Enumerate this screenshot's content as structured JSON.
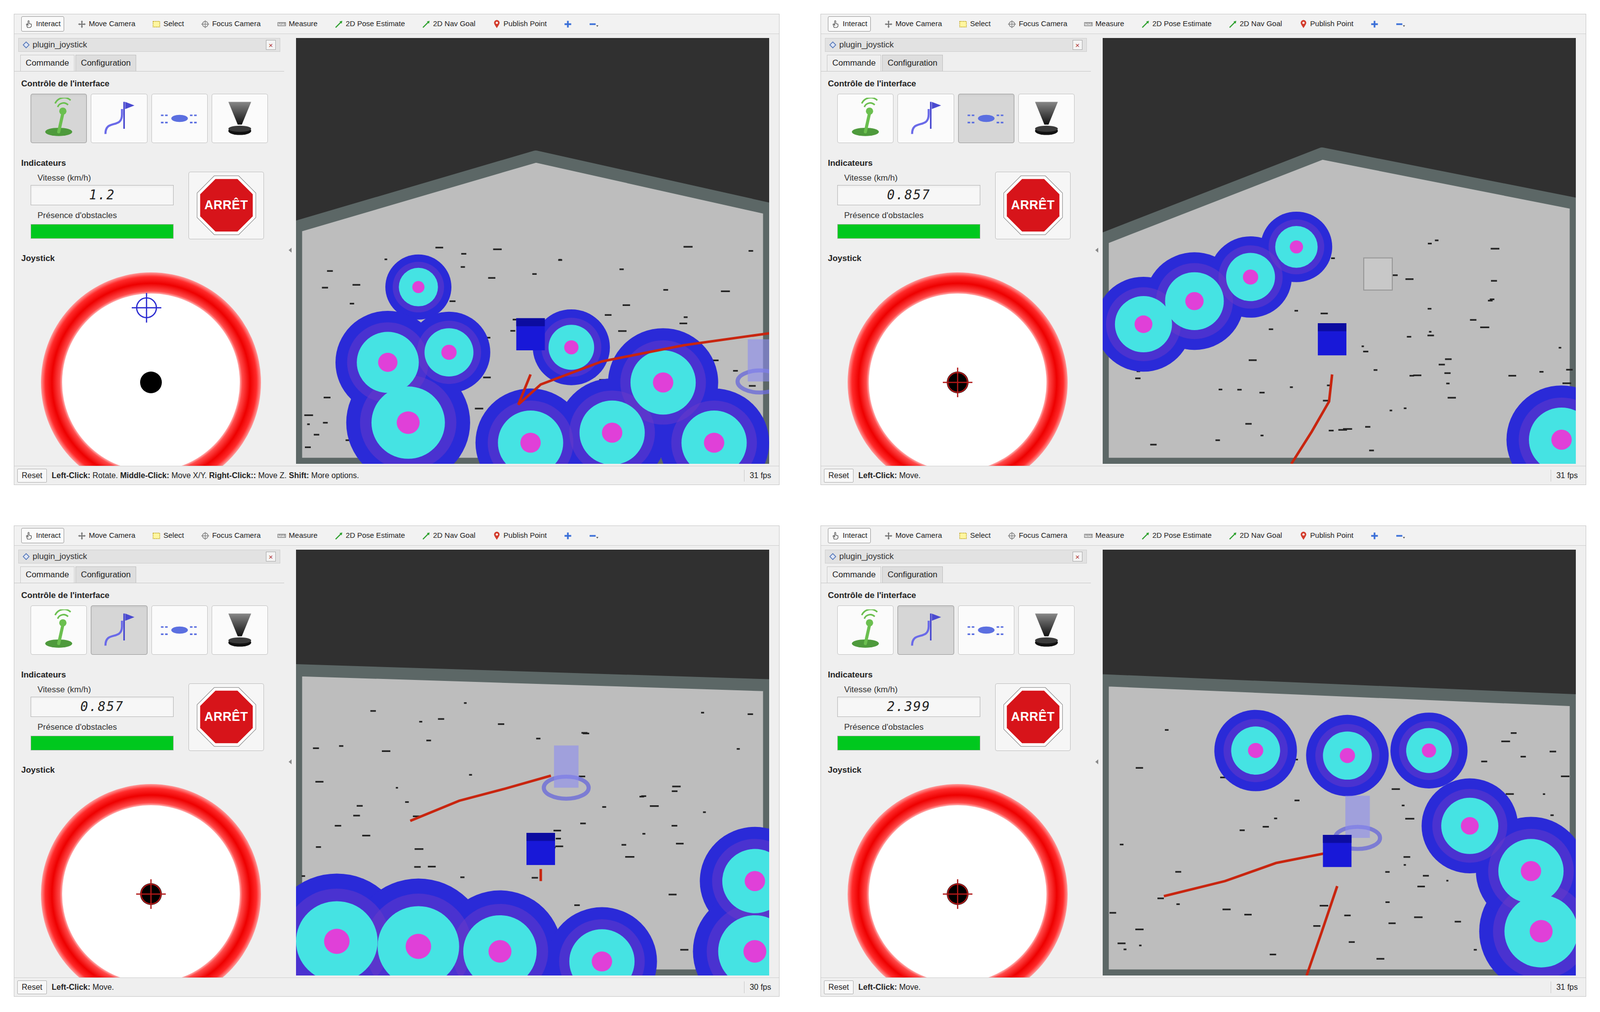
{
  "screens": [
    {
      "toolbar": [
        {
          "label": "Interact",
          "kind": "interact",
          "selected": true
        },
        {
          "label": "Move Camera",
          "kind": "move",
          "selected": false
        },
        {
          "label": "Select",
          "kind": "select",
          "selected": false
        },
        {
          "label": "Focus Camera",
          "kind": "focus",
          "selected": false
        },
        {
          "label": "Measure",
          "kind": "measure",
          "selected": false
        },
        {
          "label": "2D Pose Estimate",
          "kind": "pose",
          "selected": false
        },
        {
          "label": "2D Nav Goal",
          "kind": "goal",
          "selected": false
        },
        {
          "label": "Publish Point",
          "kind": "point",
          "selected": false
        },
        {
          "kind": "plus",
          "selected": false
        },
        {
          "kind": "minus",
          "selected": false
        }
      ],
      "dock_title": "plugin_joystick",
      "close": "×",
      "tabs": [
        {
          "label": "Commande",
          "selected": true
        },
        {
          "label": "Configuration",
          "selected": false
        }
      ],
      "mode_heading": "Contrôle de l'interface",
      "modes": [
        {
          "kind": "joystick",
          "selected": true
        },
        {
          "kind": "path",
          "selected": false
        },
        {
          "kind": "drone",
          "selected": false
        },
        {
          "kind": "cone",
          "selected": false
        }
      ],
      "indicators_heading": "Indicateurs",
      "speed_label": "Vitesse (km/h)",
      "speed": "1.2",
      "obstacle_label": "Présence d'obstacles",
      "obstacle_level": 1,
      "obstacle_color": "#00c81e",
      "stop_label": "ARRÊT",
      "joystick_label": "Joystick",
      "joystick_target": {
        "x": -0.05,
        "y": 0.84
      },
      "reset": "Reset",
      "hint": [
        {
          "text": "Left-Click:",
          "bold": true
        },
        {
          "text": " Rotate. ",
          "bold": false
        },
        {
          "text": "Middle-Click:",
          "bold": true
        },
        {
          "text": " Move X/Y. ",
          "bold": false
        },
        {
          "text": "Right-Click::",
          "bold": true
        },
        {
          "text": " Move Z. ",
          "bold": false
        },
        {
          "text": "Shift:",
          "bold": true
        },
        {
          "text": " More options.",
          "bold": false
        }
      ],
      "fps": "31 fps"
    },
    {
      "toolbar": [
        {
          "label": "Interact",
          "kind": "interact",
          "selected": true
        },
        {
          "label": "Move Camera",
          "kind": "move",
          "selected": false
        },
        {
          "label": "Select",
          "kind": "select",
          "selected": false
        },
        {
          "label": "Focus Camera",
          "kind": "focus",
          "selected": false
        },
        {
          "label": "Measure",
          "kind": "measure",
          "selected": false
        },
        {
          "label": "2D Pose Estimate",
          "kind": "pose",
          "selected": false
        },
        {
          "label": "2D Nav Goal",
          "kind": "goal",
          "selected": false
        },
        {
          "label": "Publish Point",
          "kind": "point",
          "selected": false
        },
        {
          "kind": "plus",
          "selected": false
        },
        {
          "kind": "minus",
          "selected": false
        }
      ],
      "dock_title": "plugin_joystick",
      "close": "×",
      "tabs": [
        {
          "label": "Commande",
          "selected": true
        },
        {
          "label": "Configuration",
          "selected": false
        }
      ],
      "mode_heading": "Contrôle de l'interface",
      "modes": [
        {
          "kind": "joystick",
          "selected": false
        },
        {
          "kind": "path",
          "selected": false
        },
        {
          "kind": "drone",
          "selected": true
        },
        {
          "kind": "cone",
          "selected": false
        }
      ],
      "indicators_heading": "Indicateurs",
      "speed_label": "Vitesse (km/h)",
      "speed": "0.857",
      "obstacle_label": "Présence d'obstacles",
      "obstacle_level": 1,
      "obstacle_color": "#00c81e",
      "stop_label": "ARRÊT",
      "joystick_label": "Joystick",
      "joystick_target": {
        "x": 0,
        "y": 0
      },
      "reset": "Reset",
      "hint": [
        {
          "text": "Left-Click:",
          "bold": true
        },
        {
          "text": " Move.",
          "bold": false
        }
      ],
      "fps": "31 fps"
    },
    {
      "toolbar": [
        {
          "label": "Interact",
          "kind": "interact",
          "selected": true
        },
        {
          "label": "Move Camera",
          "kind": "move",
          "selected": false
        },
        {
          "label": "Select",
          "kind": "select",
          "selected": false
        },
        {
          "label": "Focus Camera",
          "kind": "focus",
          "selected": false
        },
        {
          "label": "Measure",
          "kind": "measure",
          "selected": false
        },
        {
          "label": "2D Pose Estimate",
          "kind": "pose",
          "selected": false
        },
        {
          "label": "2D Nav Goal",
          "kind": "goal",
          "selected": false
        },
        {
          "label": "Publish Point",
          "kind": "point",
          "selected": false
        },
        {
          "kind": "plus",
          "selected": false
        },
        {
          "kind": "minus",
          "selected": false
        }
      ],
      "dock_title": "plugin_joystick",
      "close": "×",
      "tabs": [
        {
          "label": "Commande",
          "selected": true
        },
        {
          "label": "Configuration",
          "selected": false
        }
      ],
      "mode_heading": "Contrôle de l'interface",
      "modes": [
        {
          "kind": "joystick",
          "selected": false
        },
        {
          "kind": "path",
          "selected": true
        },
        {
          "kind": "drone",
          "selected": false
        },
        {
          "kind": "cone",
          "selected": false
        }
      ],
      "indicators_heading": "Indicateurs",
      "speed_label": "Vitesse (km/h)",
      "speed": "0.857",
      "obstacle_label": "Présence d'obstacles",
      "obstacle_level": 1,
      "obstacle_color": "#00c81e",
      "stop_label": "ARRÊT",
      "joystick_label": "Joystick",
      "joystick_target": {
        "x": 0,
        "y": 0
      },
      "reset": "Reset",
      "hint": [
        {
          "text": "Left-Click:",
          "bold": true
        },
        {
          "text": " Move.",
          "bold": false
        }
      ],
      "fps": "30 fps"
    },
    {
      "toolbar": [
        {
          "label": "Interact",
          "kind": "interact",
          "selected": true
        },
        {
          "label": "Move Camera",
          "kind": "move",
          "selected": false
        },
        {
          "label": "Select",
          "kind": "select",
          "selected": false
        },
        {
          "label": "Focus Camera",
          "kind": "focus",
          "selected": false
        },
        {
          "label": "Measure",
          "kind": "measure",
          "selected": false
        },
        {
          "label": "2D Pose Estimate",
          "kind": "pose",
          "selected": false
        },
        {
          "label": "2D Nav Goal",
          "kind": "goal",
          "selected": false
        },
        {
          "label": "Publish Point",
          "kind": "point",
          "selected": false
        },
        {
          "kind": "plus",
          "selected": false
        },
        {
          "kind": "minus",
          "selected": false
        }
      ],
      "dock_title": "plugin_joystick",
      "close": "×",
      "tabs": [
        {
          "label": "Commande",
          "selected": true
        },
        {
          "label": "Configuration",
          "selected": false
        }
      ],
      "mode_heading": "Contrôle de l'interface",
      "modes": [
        {
          "kind": "joystick",
          "selected": false
        },
        {
          "kind": "path",
          "selected": true
        },
        {
          "kind": "drone",
          "selected": false
        },
        {
          "kind": "cone",
          "selected": false
        }
      ],
      "indicators_heading": "Indicateurs",
      "speed_label": "Vitesse (km/h)",
      "speed": "2.399",
      "obstacle_label": "Présence d'obstacles",
      "obstacle_level": 1,
      "obstacle_color": "#00c81e",
      "stop_label": "ARRÊT",
      "joystick_label": "Joystick",
      "joystick_target": {
        "x": 0,
        "y": 0
      },
      "reset": "Reset",
      "hint": [
        {
          "text": "Left-Click:",
          "bold": true
        },
        {
          "text": " Move.",
          "bold": false
        }
      ],
      "fps": "31 fps"
    }
  ]
}
